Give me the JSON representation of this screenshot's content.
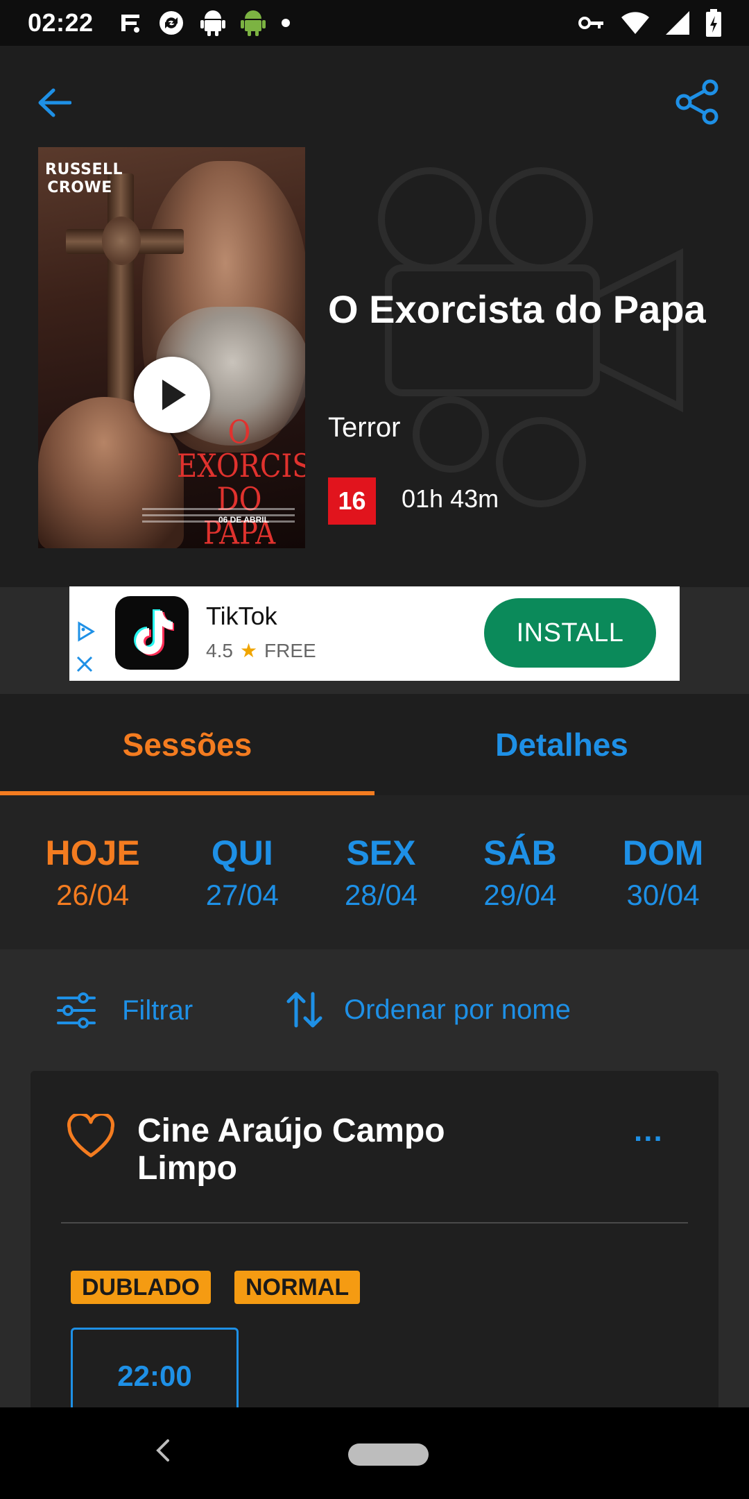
{
  "status_bar": {
    "time": "02:22",
    "left_icons": [
      "fitness-icon",
      "refresh-app-icon",
      "android-icon",
      "android-green-icon",
      "dot-icon"
    ],
    "right_icons": [
      "vpn-key-icon",
      "wifi-icon",
      "signal-icon",
      "battery-charging-icon"
    ]
  },
  "header": {
    "back_icon": "arrow-left-icon",
    "share_icon": "share-icon"
  },
  "movie": {
    "poster_actor": "RUSSELL CROWE",
    "poster_title": "O EXORCISTA DO PAPA",
    "poster_date": "06 DE ABRIL",
    "title": "O Exorcista do Papa",
    "genre": "Terror",
    "rating": "16",
    "duration": "01h 43m",
    "rating_color": "#e1141d"
  },
  "ad": {
    "app_name": "TikTok",
    "rating": "4.5",
    "price": "FREE",
    "install_label": "INSTALL",
    "install_color": "#0b8a5a"
  },
  "tabs": [
    {
      "label": "Sessões",
      "active": true
    },
    {
      "label": "Detalhes",
      "active": false
    }
  ],
  "days": [
    {
      "name": "HOJE",
      "date": "26/04",
      "active": true
    },
    {
      "name": "QUI",
      "date": "27/04",
      "active": false
    },
    {
      "name": "SEX",
      "date": "28/04",
      "active": false
    },
    {
      "name": "SÁB",
      "date": "29/04",
      "active": false
    },
    {
      "name": "DOM",
      "date": "30/04",
      "active": false
    }
  ],
  "filters": {
    "filter_label": "Filtrar",
    "sort_label": "Ordenar por nome"
  },
  "cinema": {
    "name": "Cine Araújo Campo Limpo",
    "more_label": "...",
    "tags": [
      "DUBLADO",
      "NORMAL"
    ],
    "sessions": [
      "22:00"
    ]
  },
  "colors": {
    "accent_orange": "#f47c20",
    "accent_blue": "#1e90e6",
    "tag_yellow": "#f59b12"
  }
}
